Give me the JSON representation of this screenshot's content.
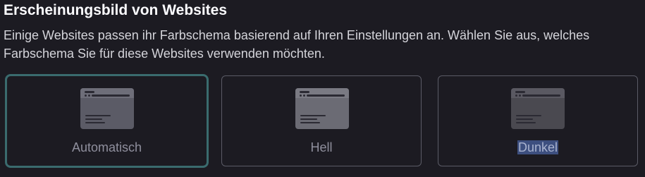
{
  "section": {
    "title": "Erscheinungsbild von Websites",
    "description": "Einige Websites passen ihr Farbschema basierend auf Ihren Einstellungen an. Wählen Sie aus, welches Farbschema Sie für diese Websites verwenden möchten."
  },
  "options": [
    {
      "label": "Automatisch",
      "selected": true
    },
    {
      "label": "Hell",
      "selected": false
    },
    {
      "label": "Dunkel",
      "selected": false,
      "text_highlighted": true
    }
  ],
  "colors": {
    "background": "#1c1b22",
    "selected_border": "#3a6b6e",
    "card_border": "#5b5b66",
    "text_selection": "#3d4f7f"
  }
}
